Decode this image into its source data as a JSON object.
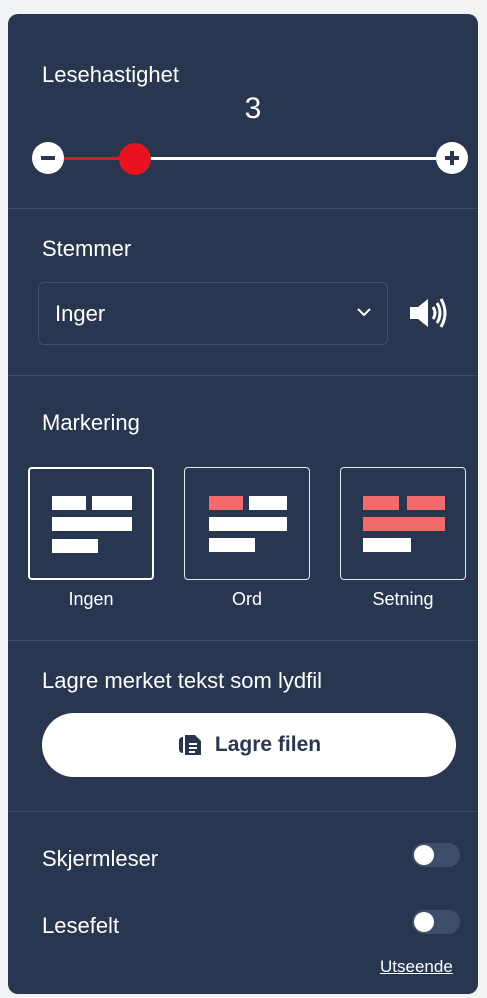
{
  "speed": {
    "label": "Lesehastighet",
    "value": "3",
    "min": 1,
    "max": 10,
    "current": 3
  },
  "voices": {
    "label": "Stemmer",
    "selected": "Inger",
    "icon": "speaker-icon"
  },
  "marking": {
    "label": "Markering",
    "options": [
      {
        "label": "Ingen",
        "selected": true
      },
      {
        "label": "Ord",
        "selected": false
      },
      {
        "label": "Setning",
        "selected": false
      }
    ],
    "highlight_color": "#f26b6b"
  },
  "save": {
    "label": "Lagre merket tekst som lydfil",
    "button": "Lagre filen",
    "icon": "save-file-icon"
  },
  "toggles": [
    {
      "label": "Skjermleser",
      "on": false
    },
    {
      "label": "Lesefelt",
      "on": false
    }
  ],
  "appearance_link": "Utseende",
  "colors": {
    "panel": "#283650",
    "accent": "#e8131e"
  }
}
